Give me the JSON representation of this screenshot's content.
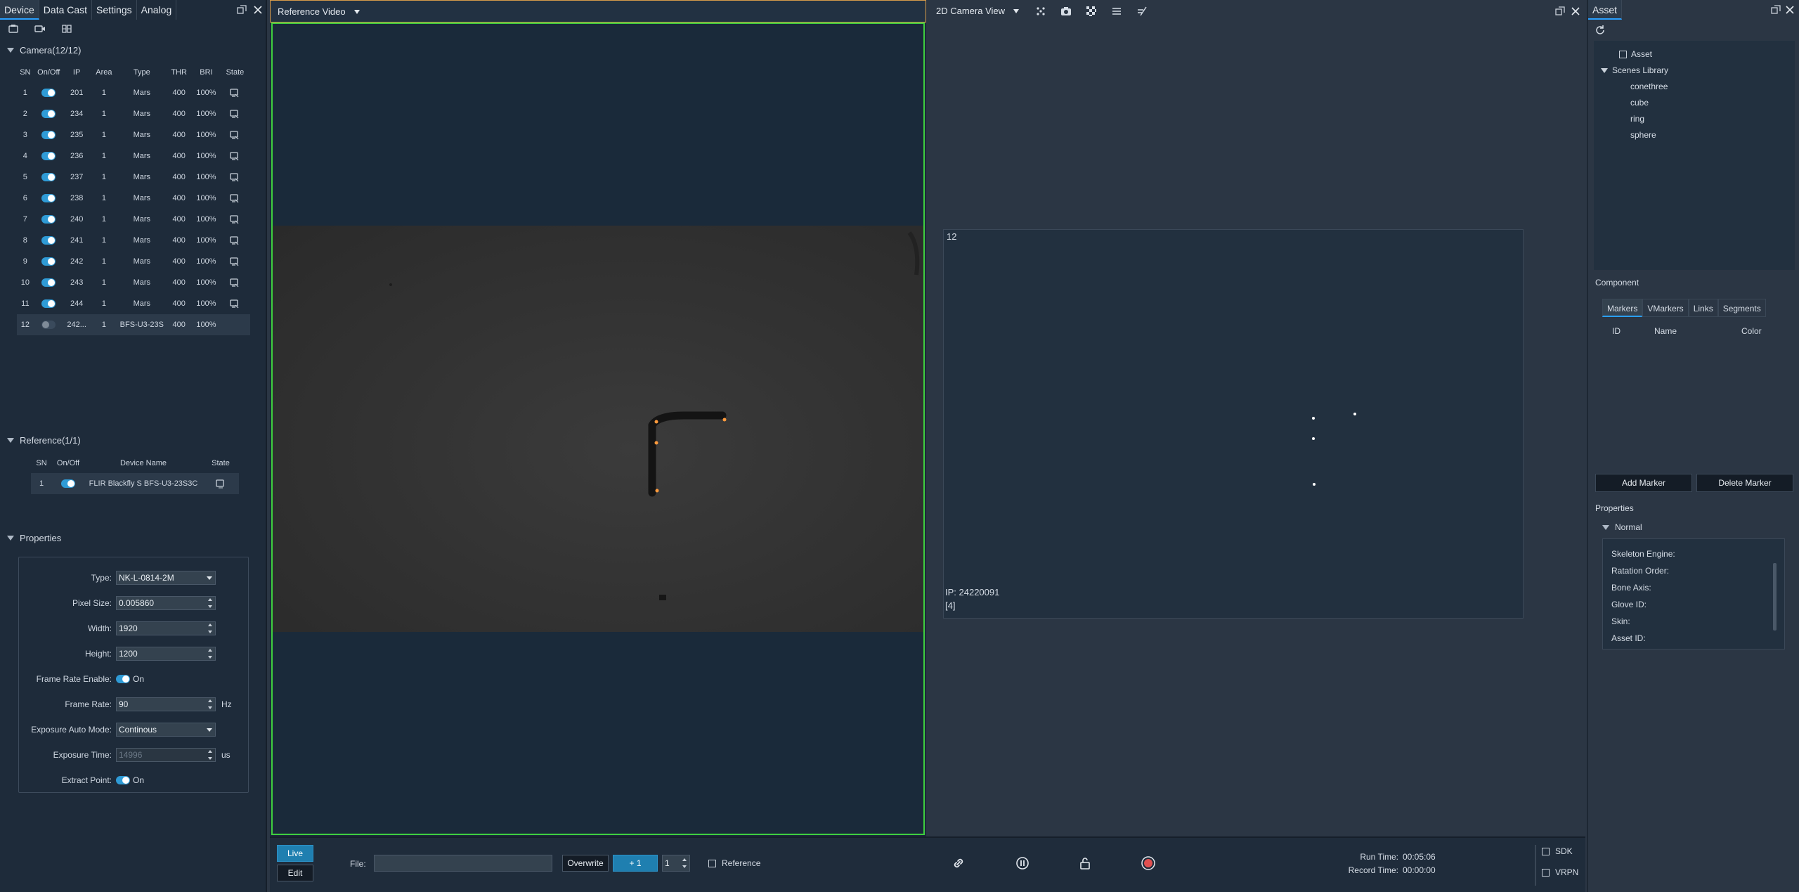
{
  "left": {
    "tabs": [
      "Device",
      "Data Cast",
      "Settings",
      "Analog"
    ],
    "camera_section": "Camera(12/12)",
    "camera_headers": [
      "SN",
      "On/Off",
      "IP",
      "Area",
      "Type",
      "THR",
      "BRI",
      "State"
    ],
    "cameras": [
      {
        "sn": "1",
        "ip": "201",
        "area": "1",
        "type": "Mars",
        "thr": "400",
        "bri": "100%"
      },
      {
        "sn": "2",
        "ip": "234",
        "area": "1",
        "type": "Mars",
        "thr": "400",
        "bri": "100%"
      },
      {
        "sn": "3",
        "ip": "235",
        "area": "1",
        "type": "Mars",
        "thr": "400",
        "bri": "100%"
      },
      {
        "sn": "4",
        "ip": "236",
        "area": "1",
        "type": "Mars",
        "thr": "400",
        "bri": "100%"
      },
      {
        "sn": "5",
        "ip": "237",
        "area": "1",
        "type": "Mars",
        "thr": "400",
        "bri": "100%"
      },
      {
        "sn": "6",
        "ip": "238",
        "area": "1",
        "type": "Mars",
        "thr": "400",
        "bri": "100%"
      },
      {
        "sn": "7",
        "ip": "240",
        "area": "1",
        "type": "Mars",
        "thr": "400",
        "bri": "100%"
      },
      {
        "sn": "8",
        "ip": "241",
        "area": "1",
        "type": "Mars",
        "thr": "400",
        "bri": "100%"
      },
      {
        "sn": "9",
        "ip": "242",
        "area": "1",
        "type": "Mars",
        "thr": "400",
        "bri": "100%"
      },
      {
        "sn": "10",
        "ip": "243",
        "area": "1",
        "type": "Mars",
        "thr": "400",
        "bri": "100%"
      },
      {
        "sn": "11",
        "ip": "244",
        "area": "1",
        "type": "Mars",
        "thr": "400",
        "bri": "100%"
      },
      {
        "sn": "12",
        "ip": "242...",
        "area": "1",
        "type": "BFS-U3-23S",
        "thr": "400",
        "bri": "100%"
      }
    ],
    "reference_section": "Reference(1/1)",
    "reference_headers": [
      "SN",
      "On/Off",
      "Device Name",
      "State"
    ],
    "reference": {
      "sn": "1",
      "device_name": "FLIR Blackfly S BFS-U3-23S3C"
    },
    "properties_section": "Properties",
    "properties": {
      "type_label": "Type:",
      "type_value": "NK-L-0814-2M",
      "pixel_label": "Pixel Size:",
      "pixel_value": "0.005860",
      "width_label": "Width:",
      "width_value": "1920",
      "height_label": "Height:",
      "height_value": "1200",
      "frame_enable_label": "Frame Rate Enable:",
      "frame_enable_value": "On",
      "frame_rate_label": "Frame Rate:",
      "frame_rate_value": "90",
      "frame_rate_unit": "Hz",
      "exposure_mode_label": "Exposure Auto Mode:",
      "exposure_mode_value": "Continous",
      "exposure_time_label": "Exposure Time:",
      "exposure_time_value": "14996",
      "exposure_time_unit": "us",
      "extract_label": "Extract Point:",
      "extract_value": "On"
    }
  },
  "reference_video": {
    "title": "Reference Video"
  },
  "camera_view": {
    "title": "2D Camera View",
    "camera_number": "12",
    "ip_text": "IP: 24220091",
    "count_text": "[4]"
  },
  "asset": {
    "tab": "Asset",
    "root": "Asset",
    "library": "Scenes Library",
    "library_items": [
      "conethree",
      "cube",
      "ring",
      "sphere"
    ],
    "component_label": "Component",
    "subtabs": [
      "Markers",
      "VMarkers",
      "Links",
      "Segments"
    ],
    "marker_headers": [
      "ID",
      "Name",
      "Color"
    ],
    "add_marker": "Add Marker",
    "delete_marker": "Delete Marker",
    "properties_label": "Properties",
    "normal_label": "Normal",
    "normal_items": [
      "Skeleton Engine:",
      "Ratation Order:",
      "Bone Axis:",
      "Glove ID:",
      "Skin:",
      "Asset ID:"
    ]
  },
  "bottom": {
    "live": "Live",
    "edit": "Edit",
    "file_label": "File:",
    "file_value": "",
    "overwrite": "Overwrite",
    "plus_one": "+ 1",
    "spin_value": "1",
    "reference": "Reference",
    "run_time_label": "Run Time:",
    "run_time_value": "00:05:06",
    "record_time_label": "Record Time:",
    "record_time_value": "00:00:00",
    "sdk": "SDK",
    "vrpn": "VRPN"
  },
  "colors": {
    "accent": "#2aa0ff",
    "video_border": "#3fcf3f",
    "record": "#e05050",
    "marker": "#ff9a3c"
  }
}
